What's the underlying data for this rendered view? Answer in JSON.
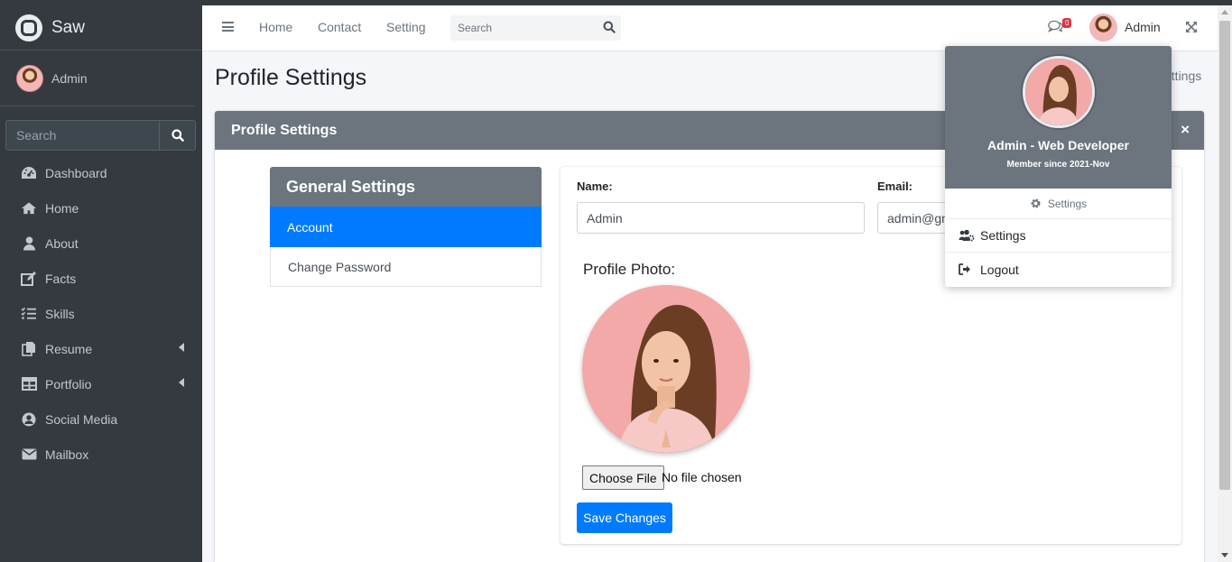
{
  "brand": {
    "name": "Saw"
  },
  "sidebar": {
    "user_name": "Admin",
    "search_placeholder": "Search",
    "items": [
      {
        "label": "Dashboard",
        "icon": "dashboard-icon"
      },
      {
        "label": "Home",
        "icon": "home-icon"
      },
      {
        "label": "About",
        "icon": "user-icon"
      },
      {
        "label": "Facts",
        "icon": "edit-icon"
      },
      {
        "label": "Skills",
        "icon": "list-check-icon"
      },
      {
        "label": "Resume",
        "icon": "copy-icon"
      },
      {
        "label": "Portfolio",
        "icon": "table-icon"
      },
      {
        "label": "Social Media",
        "icon": "user-circle-icon"
      },
      {
        "label": "Mailbox",
        "icon": "envelope-icon"
      }
    ]
  },
  "navbar": {
    "links": [
      "Home",
      "Contact",
      "Setting"
    ],
    "search_placeholder": "Search",
    "message_count": "0",
    "user_name": "Admin"
  },
  "page": {
    "title": "Profile Settings",
    "breadcrumb_visible": "ettings"
  },
  "card": {
    "title": "Profile Settings",
    "close_symbol": "×"
  },
  "settings_menu": {
    "header": "General Settings",
    "tabs": [
      "Account",
      "Change Password"
    ],
    "active_tab": "Account"
  },
  "form": {
    "name_label": "Name:",
    "name_value": "Admin",
    "email_label": "Email:",
    "email_value": "admin@gn",
    "photo_label": "Profile Photo:",
    "file_button": "Choose File",
    "file_status": "No file chosen",
    "save_button": "Save Changes"
  },
  "dropdown": {
    "title": "Admin - Web Developer",
    "member_since": "Member since 2021-Nov",
    "header_settings": "Settings",
    "items": [
      {
        "label": "Settings",
        "icon": "users-cog-icon"
      },
      {
        "label": "Logout",
        "icon": "sign-out-icon"
      }
    ]
  },
  "colors": {
    "sidebar_bg": "#343a40",
    "header_gray": "#6c757d",
    "primary": "#007bff",
    "badge": "#dc3545"
  }
}
